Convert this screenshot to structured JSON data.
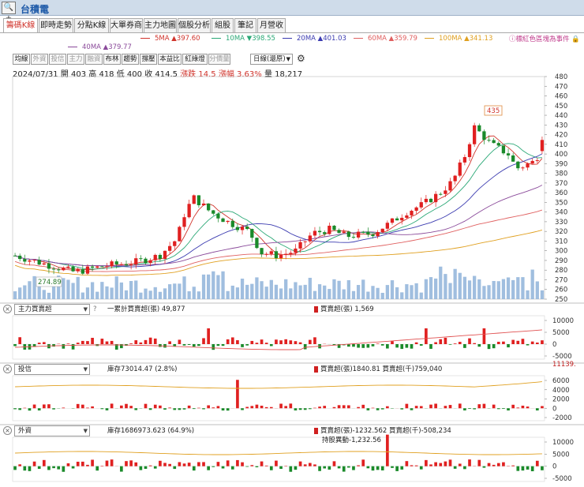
{
  "window": {
    "title": "台積電",
    "icon_name": "search-plus-icon"
  },
  "tabs": [
    "籌碼K線",
    "即時走勢",
    "分點K線",
    "大單券商",
    "主力地圖",
    "個股分析",
    "組股",
    "筆記",
    "月營收"
  ],
  "active_tab": 0,
  "ma_legend": [
    {
      "label": "5MA",
      "value": "▲397.60",
      "color": "#d0342c"
    },
    {
      "label": "10MA",
      "value": "▼398.55",
      "color": "#2aa876"
    },
    {
      "label": "20MA",
      "value": "▲401.03",
      "color": "#3b3bb0"
    },
    {
      "label": "60MA",
      "value": "▲359.79",
      "color": "#e06060"
    },
    {
      "label": "100MA",
      "value": "▲341.13",
      "color": "#e0a020"
    },
    {
      "label": "40MA",
      "value": "▲379.77",
      "color": "#8a4a9a"
    }
  ],
  "note": "標紅色區塊為事件",
  "toolbar": {
    "buttons": [
      {
        "label": "均線",
        "dim": false
      },
      {
        "label": "外資",
        "dim": true
      },
      {
        "label": "投信",
        "dim": true
      },
      {
        "label": "主力",
        "dim": true
      },
      {
        "label": "融資",
        "dim": true
      },
      {
        "label": "布林",
        "dim": false
      },
      {
        "label": "趨勢",
        "dim": false
      },
      {
        "label": "撐壓",
        "dim": false
      },
      {
        "label": "本益比",
        "dim": false
      },
      {
        "label": "紅綠燈",
        "dim": false
      },
      {
        "label": "分價量",
        "dim": true
      }
    ],
    "period": "日線(還原)"
  },
  "info": {
    "date": "2024/07/31",
    "open": "開 403",
    "high": "高 418",
    "low": "低 400",
    "close": "收 414.5",
    "change": "漲跌 14.5",
    "pct": "漲幅 3.63%",
    "volume": "量 18,217"
  },
  "colors": {
    "up": "#e02020",
    "down": "#1a8a2a",
    "volume": "#8fb3d9"
  },
  "main_axis": {
    "min": 250,
    "max": 480,
    "step": 10
  },
  "main_annotations": {
    "high_label": "435",
    "low_label": "274.89"
  },
  "panels": [
    {
      "name": "主力買賣超",
      "legend1": "一累計買賣超(張) 49,877",
      "legend2": "買賣超(張) 1,569",
      "legend3": "",
      "right_value": "",
      "ticks": [
        "10000",
        "5000",
        "0",
        "-5000"
      ]
    },
    {
      "name": "投信",
      "legend1": "庫存73014.47 (2.8%)",
      "legend2": "買賣超(張)1840.81 買賣超(千)759,040",
      "legend3": "",
      "right_value": "11139.",
      "ticks": [
        "6000",
        "4000",
        "2000",
        "0",
        "-2000"
      ]
    },
    {
      "name": "外資",
      "legend1": "庫存1686973.623 (64.9%)",
      "legend2": "買賣超(張)-1232.562 買賣超(千)-508,234",
      "legend3": "持股異動-1,232.56",
      "right_value": "",
      "ticks": [
        "10000",
        "5000",
        "0",
        "-5000"
      ]
    }
  ],
  "help_mark": "?"
}
